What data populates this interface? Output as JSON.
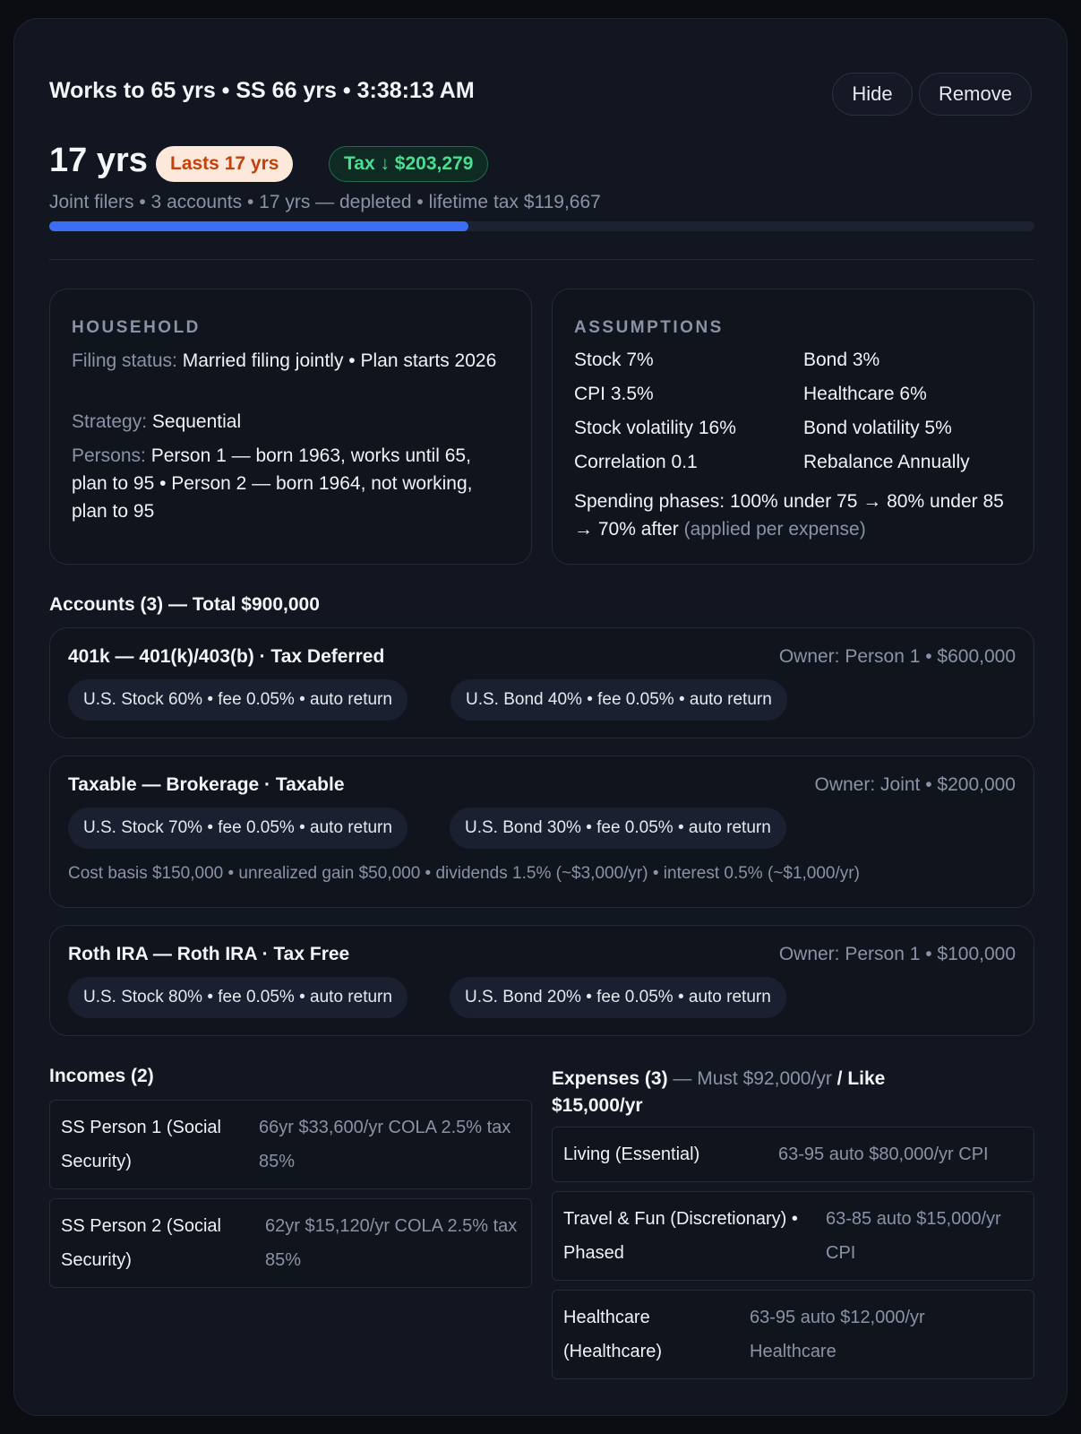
{
  "header": {
    "title": "Works to 65 yrs • SS 66 yrs • 3:38:13 AM",
    "hide_label": "Hide",
    "remove_label": "Remove"
  },
  "result": {
    "duration": "17 yrs",
    "lasts_badge": "Lasts 17 yrs",
    "tax_badge": "Tax ↓ $203,279",
    "summary": "Joint filers • 3 accounts • 17 yrs — depleted • lifetime tax $119,667",
    "progress_fraction": 0.425
  },
  "household": {
    "title": "HOUSEHOLD",
    "filing_label": "Filing status:",
    "filing_value": "Married filing jointly • Plan starts 2026",
    "strategy_label": "Strategy:",
    "strategy_value": "Sequential",
    "persons_label": "Persons:",
    "persons_value": "Person 1 — born 1963, works until 65, plan to 95 • Person 2 — born 1964, not working, plan to 95"
  },
  "assumptions": {
    "title": "ASSUMPTIONS",
    "stock": "Stock 7%",
    "bond": "Bond 3%",
    "cpi": "CPI 3.5%",
    "healthcare": "Healthcare 6%",
    "stock_vol": "Stock volatility 16%",
    "bond_vol": "Bond volatility 5%",
    "correlation": "Correlation 0.1",
    "rebalance": "Rebalance Annually",
    "phases": "Spending phases: 100% under 75 → 80% under 85 → 70% after",
    "phases_note": "(applied per expense)"
  },
  "accounts": {
    "title": "Accounts (3) — Total $900,000",
    "items": [
      {
        "name": "401k — 401(k)/403(b) · Tax Deferred",
        "owner": "Owner: Person 1 • $600,000",
        "chip1": "U.S. Stock 60% • fee 0.05% • auto return",
        "chip2": "U.S. Bond 40% • fee 0.05% • auto return"
      },
      {
        "name": "Taxable — Brokerage · Taxable",
        "owner": "Owner: Joint • $200,000",
        "chip1": "U.S. Stock 70% • fee 0.05% • auto return",
        "chip2": "U.S. Bond 30% • fee 0.05% • auto return",
        "note": "Cost basis $150,000 • unrealized gain $50,000 • dividends 1.5% (~$3,000/yr) • interest 0.5% (~$1,000/yr)"
      },
      {
        "name": "Roth IRA — Roth IRA · Tax Free",
        "owner": "Owner: Person 1 • $100,000",
        "chip1": "U.S. Stock 80% • fee 0.05% • auto return",
        "chip2": "U.S. Bond 20% • fee 0.05% • auto return"
      }
    ]
  },
  "incomes": {
    "title": "Incomes (2)",
    "items": [
      {
        "label": "SS Person 1 (Social Security)",
        "value": "66yr $33,600/yr COLA 2.5% tax 85%"
      },
      {
        "label": "SS Person 2 (Social Security)",
        "value": "62yr $15,120/yr COLA 2.5% tax 85%"
      }
    ]
  },
  "expenses": {
    "title_bold": "Expenses (3)",
    "title_must": " — Must $92,000/yr ",
    "title_like": "/ Like $15,000/yr",
    "items": [
      {
        "label": "Living (Essential)",
        "value": "63-95 auto $80,000/yr CPI"
      },
      {
        "label": "Travel & Fun (Discretionary) • Phased",
        "value": "63-85 auto $15,000/yr CPI"
      },
      {
        "label": "Healthcare (Healthcare)",
        "value": "63-95 auto $12,000/yr Healthcare"
      }
    ]
  }
}
